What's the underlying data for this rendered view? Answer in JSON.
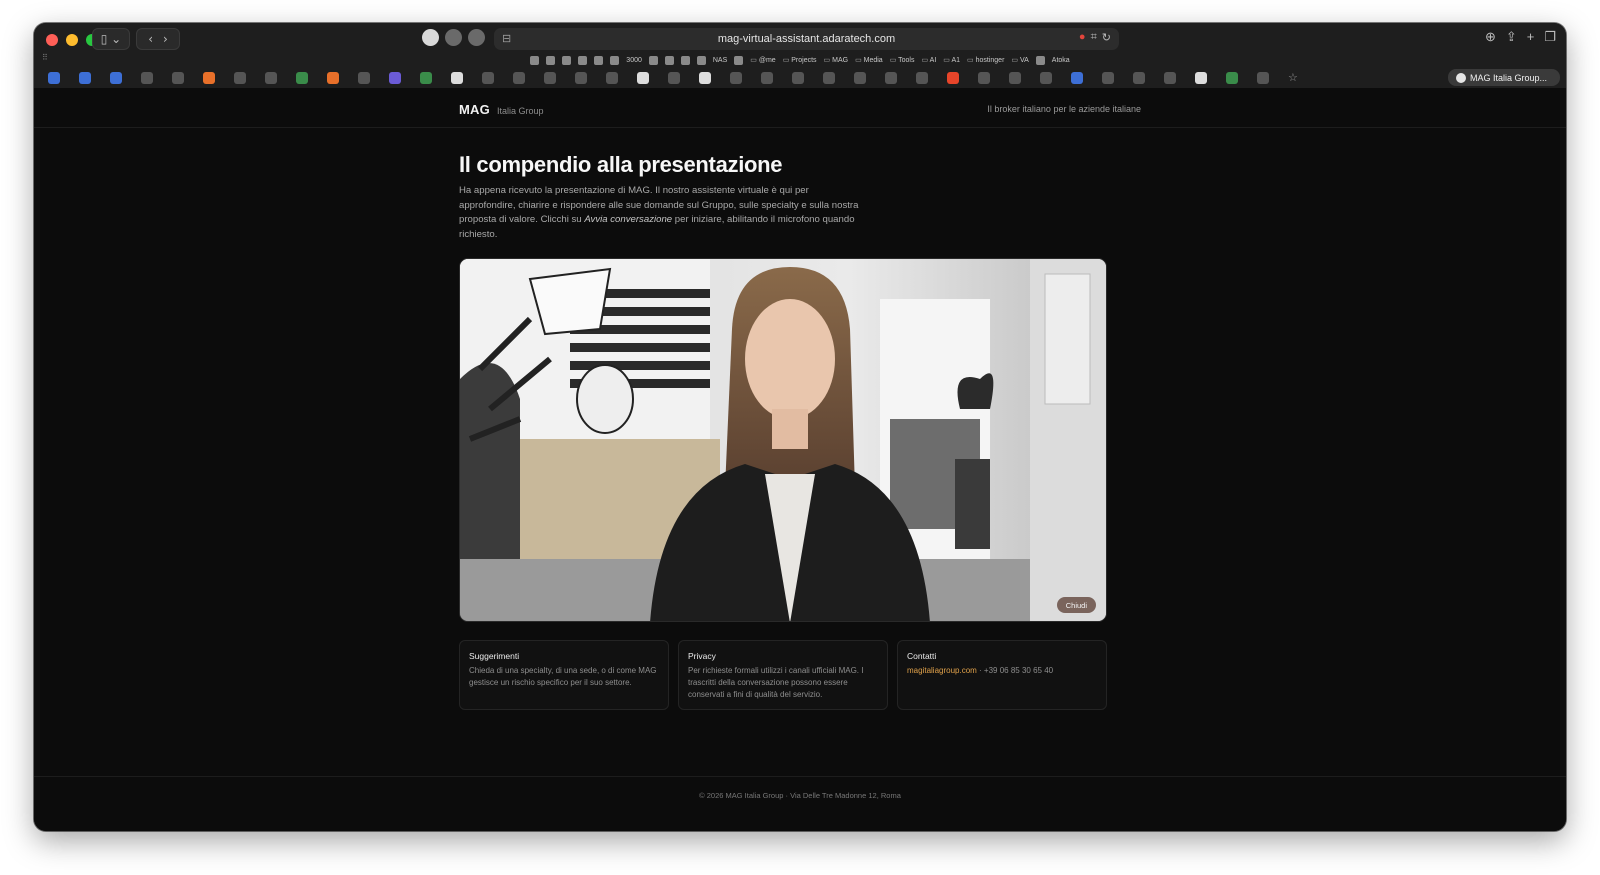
{
  "browser": {
    "url": "mag-virtual-assistant.adaratech.com",
    "bookmarks": [
      {
        "type": "link",
        "label": "3000"
      },
      {
        "type": "link",
        "label": "NAS"
      },
      {
        "type": "folder",
        "label": "@me"
      },
      {
        "type": "folder",
        "label": "Projects"
      },
      {
        "type": "folder",
        "label": "MAG"
      },
      {
        "type": "folder",
        "label": "Media"
      },
      {
        "type": "folder",
        "label": "Tools"
      },
      {
        "type": "folder",
        "label": "AI"
      },
      {
        "type": "folder",
        "label": "A1"
      },
      {
        "type": "folder",
        "label": "hostinger"
      },
      {
        "type": "folder",
        "label": "VA"
      },
      {
        "type": "link",
        "label": "Atoka"
      }
    ],
    "active_tab": "MAG Italia Group..."
  },
  "header": {
    "brand": "MAG",
    "brand_sub": "Italia Group",
    "tagline": "Il broker italiano per le aziende italiane"
  },
  "hero": {
    "title": "Il compendio alla presentazione",
    "intro_before": "Ha appena ricevuto la presentazione di MAG. Il nostro assistente virtuale è qui per approfondire, chiarire e rispondere alle sue domande sul Gruppo, sulle specialty e sulla nostra proposta di valore. Clicchi su ",
    "intro_em": "Avvia conversazione",
    "intro_after": " per iniziare, abilitando il microfono quando richiesto."
  },
  "video": {
    "close_label": "Chiudi"
  },
  "cards": [
    {
      "title": "Suggerimenti",
      "body": "Chieda di una specialty, di una sede, o di come MAG gestisce un rischio specifico per il suo settore."
    },
    {
      "title": "Privacy",
      "body": "Per richieste formali utilizzi i canali ufficiali MAG. I trascritti della conversazione possono essere conservati a fini di qualità del servizio."
    },
    {
      "title": "Contatti",
      "link": "magitaliagroup.com",
      "body": " · +39 06 85 30 65 40"
    }
  ],
  "footer": {
    "text": "© 2026 MAG Italia Group · Via Delle Tre Madonne 12, Roma"
  },
  "colors": {
    "background": "#0c0c0c",
    "accent_link": "#e0a14a"
  }
}
